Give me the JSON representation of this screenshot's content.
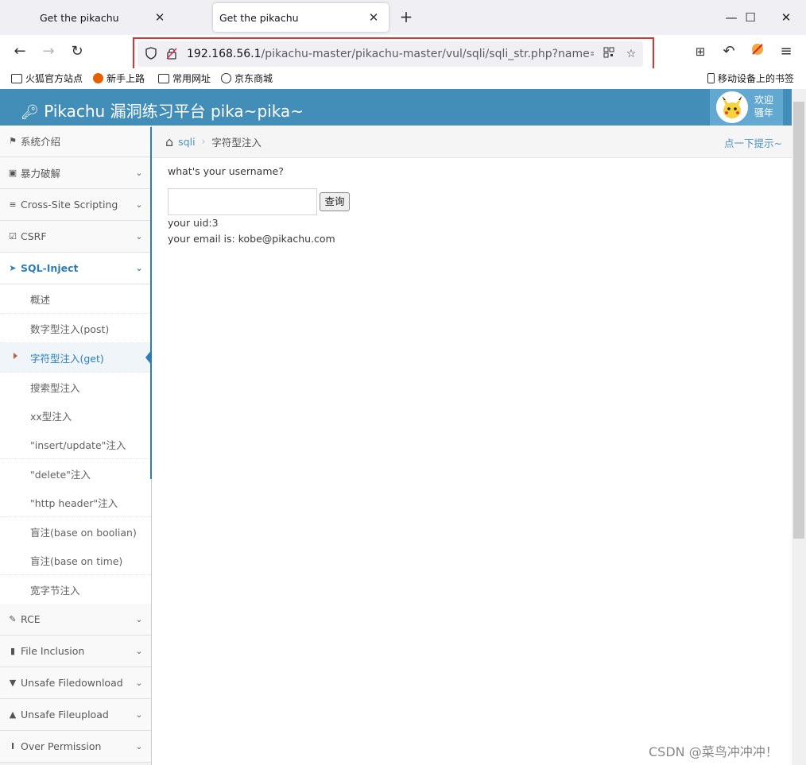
{
  "browser": {
    "tabs": [
      {
        "title": "Get the pikachu"
      },
      {
        "title": "Get the pikachu"
      }
    ],
    "url_host": "192.168.56.1",
    "url_path": "/pikachu-master/pikachu-master/vul/sqli/sqli_str.php?name=kobe",
    "bookmarks": [
      "火狐官方站点",
      "新手上路",
      "常用网址",
      "京东商城"
    ],
    "mobile_bookmarks": "移动设备上的书签"
  },
  "header": {
    "brand": "Pikachu 漏洞练习平台 pika~pika~",
    "welcome_line1": "欢迎",
    "welcome_line2": "骚年"
  },
  "sidebar": {
    "items": [
      {
        "label": "系统介绍"
      },
      {
        "label": "暴力破解"
      },
      {
        "label": "Cross-Site Scripting"
      },
      {
        "label": "CSRF"
      },
      {
        "label": "SQL-Inject"
      },
      {
        "label": "RCE"
      },
      {
        "label": "File Inclusion"
      },
      {
        "label": "Unsafe Filedownload"
      },
      {
        "label": "Unsafe Fileupload"
      },
      {
        "label": "Over Permission"
      }
    ],
    "sub_items": [
      {
        "label": "概述"
      },
      {
        "label": "数字型注入(post)"
      },
      {
        "label": "字符型注入(get)"
      },
      {
        "label": "搜索型注入"
      },
      {
        "label": "xx型注入"
      },
      {
        "label": "\"insert/update\"注入"
      },
      {
        "label": "\"delete\"注入"
      },
      {
        "label": "\"http header\"注入"
      },
      {
        "label": "盲注(base on boolian)"
      },
      {
        "label": "盲注(base on time)"
      },
      {
        "label": "宽字节注入"
      }
    ]
  },
  "breadcrumb": {
    "link": "sqli",
    "current": "字符型注入",
    "hint": "点一下提示~"
  },
  "main": {
    "question": "what's your username?",
    "input_value": "",
    "button": "查询",
    "uid_line": "your uid:3",
    "email_line": "your email is: kobe@pikachu.com"
  },
  "watermark": "CSDN @菜鸟冲冲冲！",
  "colors": {
    "header_bg": "#438eb9",
    "accent": "#2b7dbc",
    "url_highlight": "#e0312c"
  }
}
